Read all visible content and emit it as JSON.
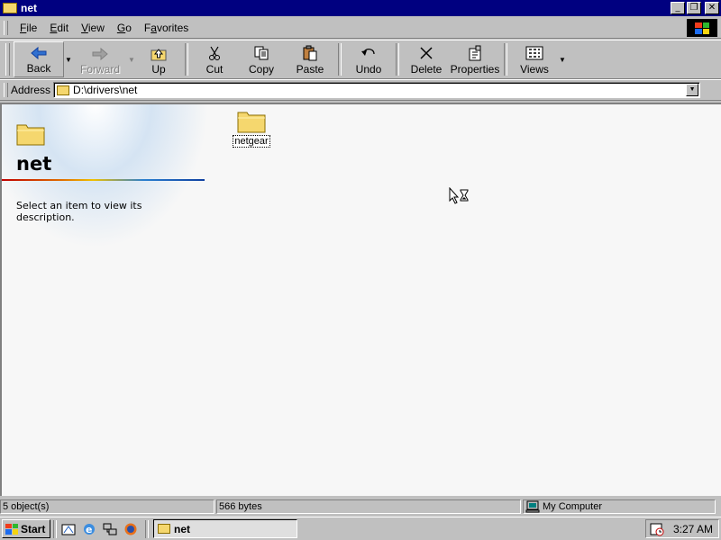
{
  "window": {
    "title": "net"
  },
  "menu": {
    "items": [
      "File",
      "Edit",
      "View",
      "Go",
      "Favorites"
    ],
    "accel": [
      "F",
      "E",
      "V",
      "G",
      "a"
    ]
  },
  "toolbar": {
    "back": "Back",
    "forward": "Forward",
    "up": "Up",
    "cut": "Cut",
    "copy": "Copy",
    "paste": "Paste",
    "undo": "Undo",
    "delete": "Delete",
    "properties": "Properties",
    "views": "Views"
  },
  "address": {
    "label": "Address",
    "value": "D:\\drivers\\net"
  },
  "panel": {
    "title": "net",
    "description": "Select an item to view its description."
  },
  "files": [
    {
      "name": "netgear",
      "icon": "folder-icon"
    }
  ],
  "status": {
    "objects": "5 object(s)",
    "size": "566 bytes",
    "zone": "My Computer"
  },
  "taskbar": {
    "start": "Start",
    "task": "net",
    "clock": "3:27 AM"
  },
  "colors": {
    "titlebar": "#000080",
    "face": "#c0c0c0",
    "content": "#f7f7f7"
  }
}
